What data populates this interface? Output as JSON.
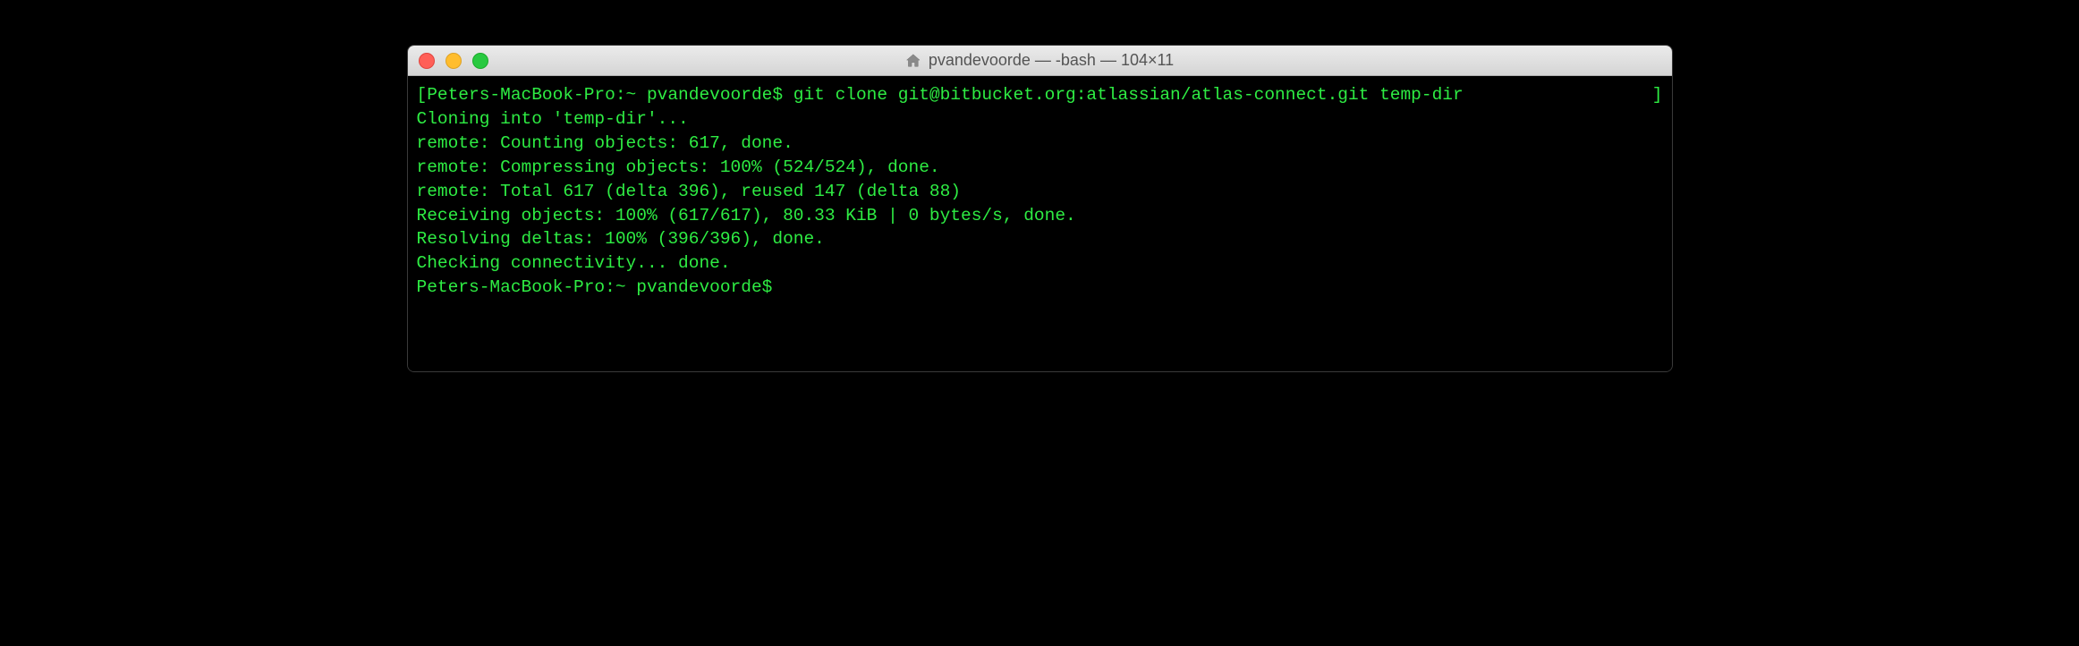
{
  "window": {
    "title": "pvandevoorde — -bash — 104×11"
  },
  "terminal": {
    "prompt_host": "Peters-MacBook-Pro",
    "prompt_path": "~",
    "prompt_user": "pvandevoorde",
    "prompt_symbol": "$",
    "command": "git clone git@bitbucket.org:atlassian/atlas-connect.git temp-dir",
    "prompt_line_full": "Peters-MacBook-Pro:~ pvandevoorde$ git clone git@bitbucket.org:atlassian/atlas-connect.git temp-dir",
    "open_bracket": "[",
    "close_bracket": "]",
    "output_lines": [
      "Cloning into 'temp-dir'...",
      "remote: Counting objects: 617, done.",
      "remote: Compressing objects: 100% (524/524), done.",
      "remote: Total 617 (delta 396), reused 147 (delta 88)",
      "Receiving objects: 100% (617/617), 80.33 KiB | 0 bytes/s, done.",
      "Resolving deltas: 100% (396/396), done.",
      "Checking connectivity... done."
    ],
    "final_prompt": "Peters-MacBook-Pro:~ pvandevoorde$ "
  }
}
